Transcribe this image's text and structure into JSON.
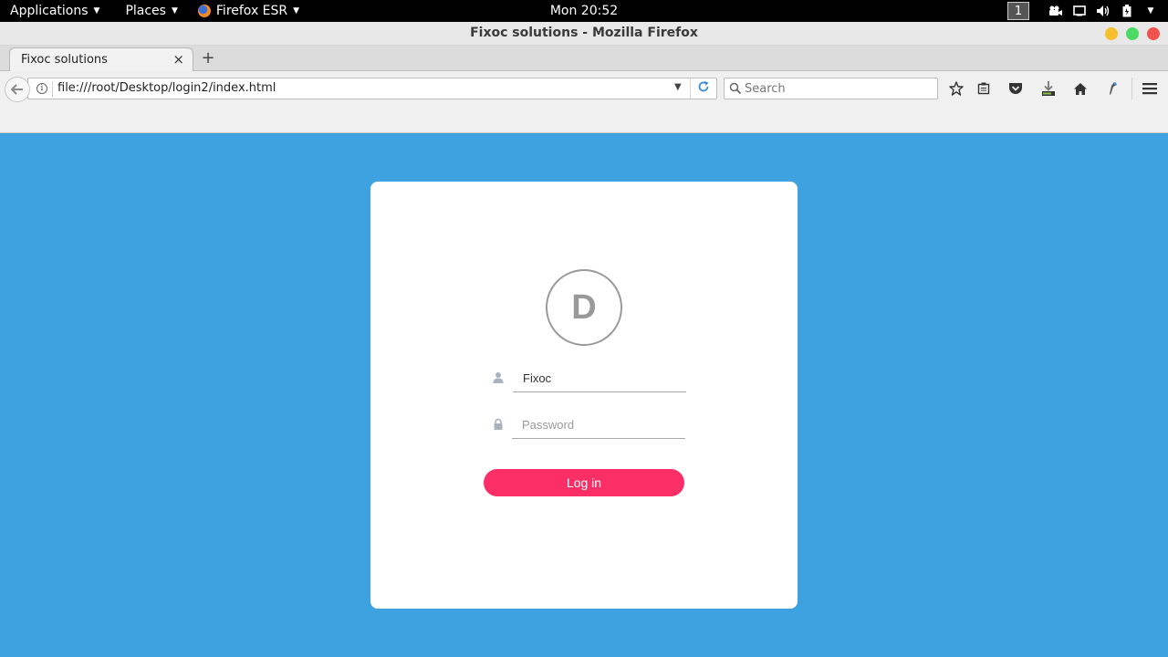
{
  "panel": {
    "applications_label": "Applications",
    "places_label": "Places",
    "app_label": "Firefox ESR",
    "clock": "Mon 20:52",
    "workspace": "1"
  },
  "window": {
    "title": "Fixoc solutions - Mozilla Firefox"
  },
  "browser": {
    "tab_title": "Fixoc solutions",
    "tab_close": "×",
    "new_tab": "+",
    "url": "file:///root/Desktop/login2/index.html",
    "search_placeholder": "Search"
  },
  "login": {
    "avatar_letter": "D",
    "username_value": "Fixoc",
    "password_placeholder": "Password",
    "button_label": "Log in"
  },
  "colors": {
    "background": "#3ea2e0",
    "button": "#fb2f66"
  },
  "icons": [
    "firefox-icon",
    "back-arrow-icon",
    "info-icon",
    "dropdown-arrow-icon",
    "reload-icon",
    "search-icon",
    "bookmark-star-icon",
    "reading-list-icon",
    "pocket-icon",
    "download-icon",
    "home-icon",
    "pointer-icon",
    "hamburger-menu-icon",
    "user-icon",
    "lock-icon",
    "camera-icon",
    "screen-icon",
    "volume-icon",
    "battery-icon"
  ]
}
